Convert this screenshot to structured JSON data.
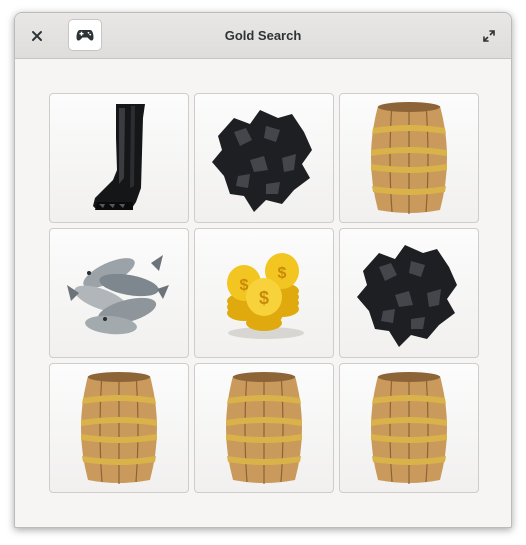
{
  "window": {
    "title": "Gold Search"
  },
  "headerbar": {
    "close_icon": "close-icon",
    "app_icon": "gamepad-icon",
    "maximize_icon": "maximize-icon"
  },
  "tiles": [
    {
      "item": "boot"
    },
    {
      "item": "coal"
    },
    {
      "item": "barrel"
    },
    {
      "item": "fish"
    },
    {
      "item": "gold-coins"
    },
    {
      "item": "coal"
    },
    {
      "item": "barrel"
    },
    {
      "item": "barrel"
    },
    {
      "item": "barrel"
    }
  ],
  "colors": {
    "headerbar": "#e3e1df",
    "window_bg": "#f6f5f4",
    "gold": "#f2c520",
    "coal": "#1e1f22",
    "wood": "#c99a5c"
  }
}
